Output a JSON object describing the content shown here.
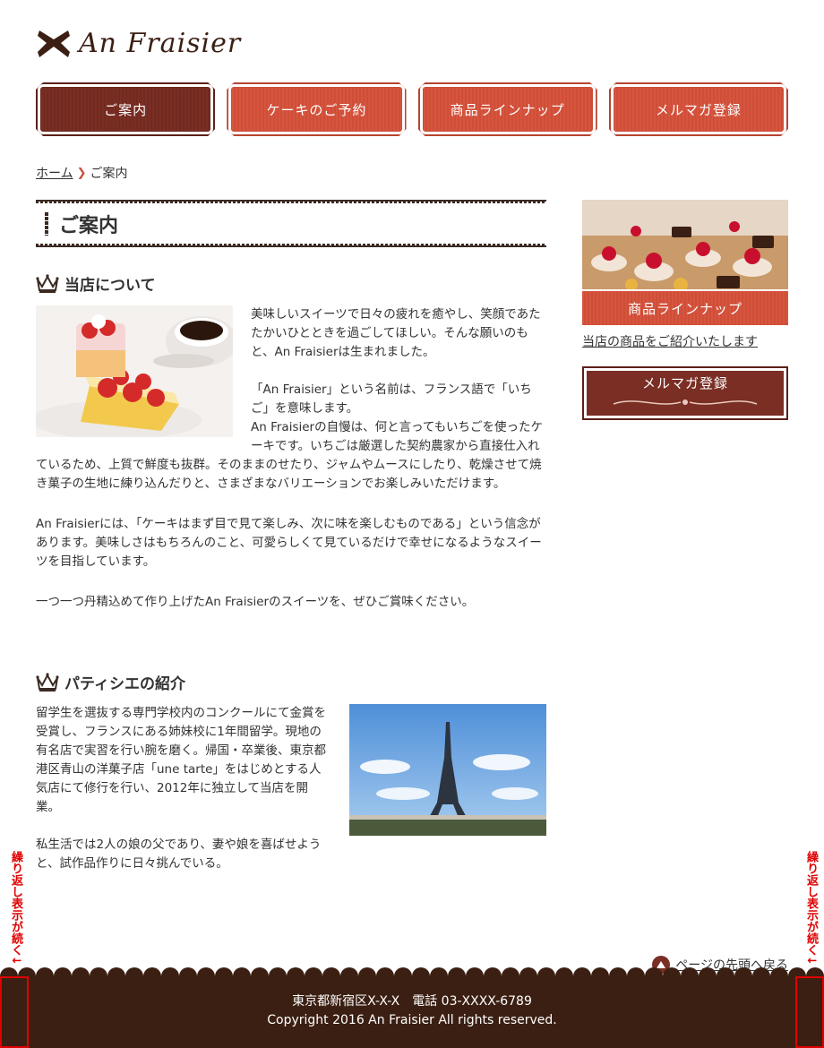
{
  "brand": {
    "name": "An Fraisier"
  },
  "nav": {
    "items": [
      {
        "label": "ご案内",
        "active": true
      },
      {
        "label": "ケーキのご予約",
        "active": false
      },
      {
        "label": "商品ラインナップ",
        "active": false
      },
      {
        "label": "メルマガ登録",
        "active": false
      }
    ]
  },
  "breadcrumb": {
    "home": "ホーム",
    "current": "ご案内"
  },
  "page": {
    "title": "ご案内"
  },
  "about": {
    "heading": "当店について",
    "p1": "美味しいスイーツで日々の疲れを癒やし、笑顔であたたかいひとときを過ごしてほしい。そんな願いのもと、An Fraisierは生まれました。",
    "p2a": "「An Fraisier」という名前は、フランス語で「いちご」を意味します。",
    "p2b": "An Fraisierの自慢は、何と言ってもいちごを使ったケーキです。いちごは厳選した契約農家から直接仕入れているため、上質で鮮度も抜群。そのままのせたり、ジャムやムースにしたり、乾燥させて焼き菓子の生地に練り込んだりと、さまざまなバリエーションでお楽しみいただけます。",
    "p3": "An Fraisierには、「ケーキはまず目で見て楽しみ、次に味を楽しむものである」という信念があります。美味しさはもちろんのこと、可愛らしくて見ているだけで幸せになるようなスイーツを目指しています。",
    "p4": "一つ一つ丹精込めて作り上げたAn Fraisierのスイーツを、ぜひご賞味ください。"
  },
  "patissier": {
    "heading": "パティシエの紹介",
    "p1": "留学生を選抜する専門学校内のコンクールにて金賞を受賞し、フランスにある姉妹校に1年間留学。現地の有名店で実習を行い腕を磨く。帰国・卒業後、東京都港区青山の洋菓子店「une tarte」をはじめとする人気店にて修行を行い、2012年に独立して当店を開業。",
    "p2": "私生活では2人の娘の父であり、妻や娘を喜ばせようと、試作品作りに日々挑んでいる。"
  },
  "sidebar": {
    "lineup_banner": "商品ラインナップ",
    "lineup_link": "当店の商品をご紹介いたします",
    "mail_banner": "メルマガ登録"
  },
  "to_top": "ページの先頭へ戻る",
  "footer": {
    "address": "東京都新宿区X-X-X　電話 03-XXXX-6789",
    "copyright": "Copyright 2016 An Fraisier All rights reserved."
  },
  "annotation": {
    "repeat_note": "繰り返し表示が続く↓"
  },
  "colors": {
    "accent": "#d7553f",
    "dark": "#7a2e24",
    "footer": "#3b1f12"
  }
}
